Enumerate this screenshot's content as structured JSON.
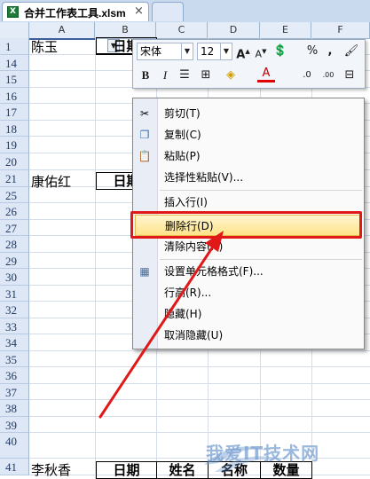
{
  "tab": {
    "title": "合并工作表工具.xlsm",
    "close": "×"
  },
  "columns": [
    "A",
    "B",
    "C",
    "D",
    "E",
    "F"
  ],
  "rows": [
    "1",
    "14",
    "15",
    "16",
    "17",
    "18",
    "19",
    "20",
    "21",
    "25",
    "26",
    "27",
    "28",
    "29",
    "30",
    "31",
    "32",
    "33",
    "34",
    "35",
    "36",
    "37",
    "38",
    "39",
    "40",
    "41"
  ],
  "cells": {
    "a1": "陈玉",
    "b1": "日期",
    "a21": "康佑红",
    "b21": "日期",
    "a41": "李秋香",
    "b41": "日期",
    "c41": "姓名",
    "d41": "名称",
    "e41": "数量"
  },
  "mini_toolbar": {
    "font_name": "宋体",
    "font_size": "12",
    "grow_font": "A",
    "shrink_font": "A",
    "percent": "%",
    "comma": ",",
    "bold": "B",
    "italic": "I",
    "font_color_letter": "A",
    "increase_decimal": ".0",
    "decrease_decimal": ".00"
  },
  "context_menu": {
    "items": [
      {
        "label": "剪切(T)",
        "icon": "scissors-icon",
        "glyph": "✂"
      },
      {
        "label": "复制(C)",
        "icon": "copy-icon",
        "glyph": "❐"
      },
      {
        "label": "粘贴(P)",
        "icon": "paste-icon",
        "glyph": "📋"
      },
      {
        "label": "选择性粘贴(V)...",
        "icon": "",
        "glyph": ""
      },
      {
        "label": "插入行(I)",
        "icon": "",
        "glyph": ""
      },
      {
        "label": "删除行(D)",
        "icon": "",
        "glyph": ""
      },
      {
        "label": "清除内容(N)",
        "icon": "",
        "glyph": ""
      },
      {
        "label": "设置单元格格式(F)...",
        "icon": "format-cells-icon",
        "glyph": "▦"
      },
      {
        "label": "行高(R)...",
        "icon": "",
        "glyph": ""
      },
      {
        "label": "隐藏(H)",
        "icon": "",
        "glyph": ""
      },
      {
        "label": "取消隐藏(U)",
        "icon": "",
        "glyph": ""
      }
    ]
  },
  "watermark": {
    "text": "我爱IT技术网"
  },
  "colors": {
    "highlight_border": "#e01818",
    "arrow": "#e01818",
    "menu_hover": "#ffe38a"
  }
}
